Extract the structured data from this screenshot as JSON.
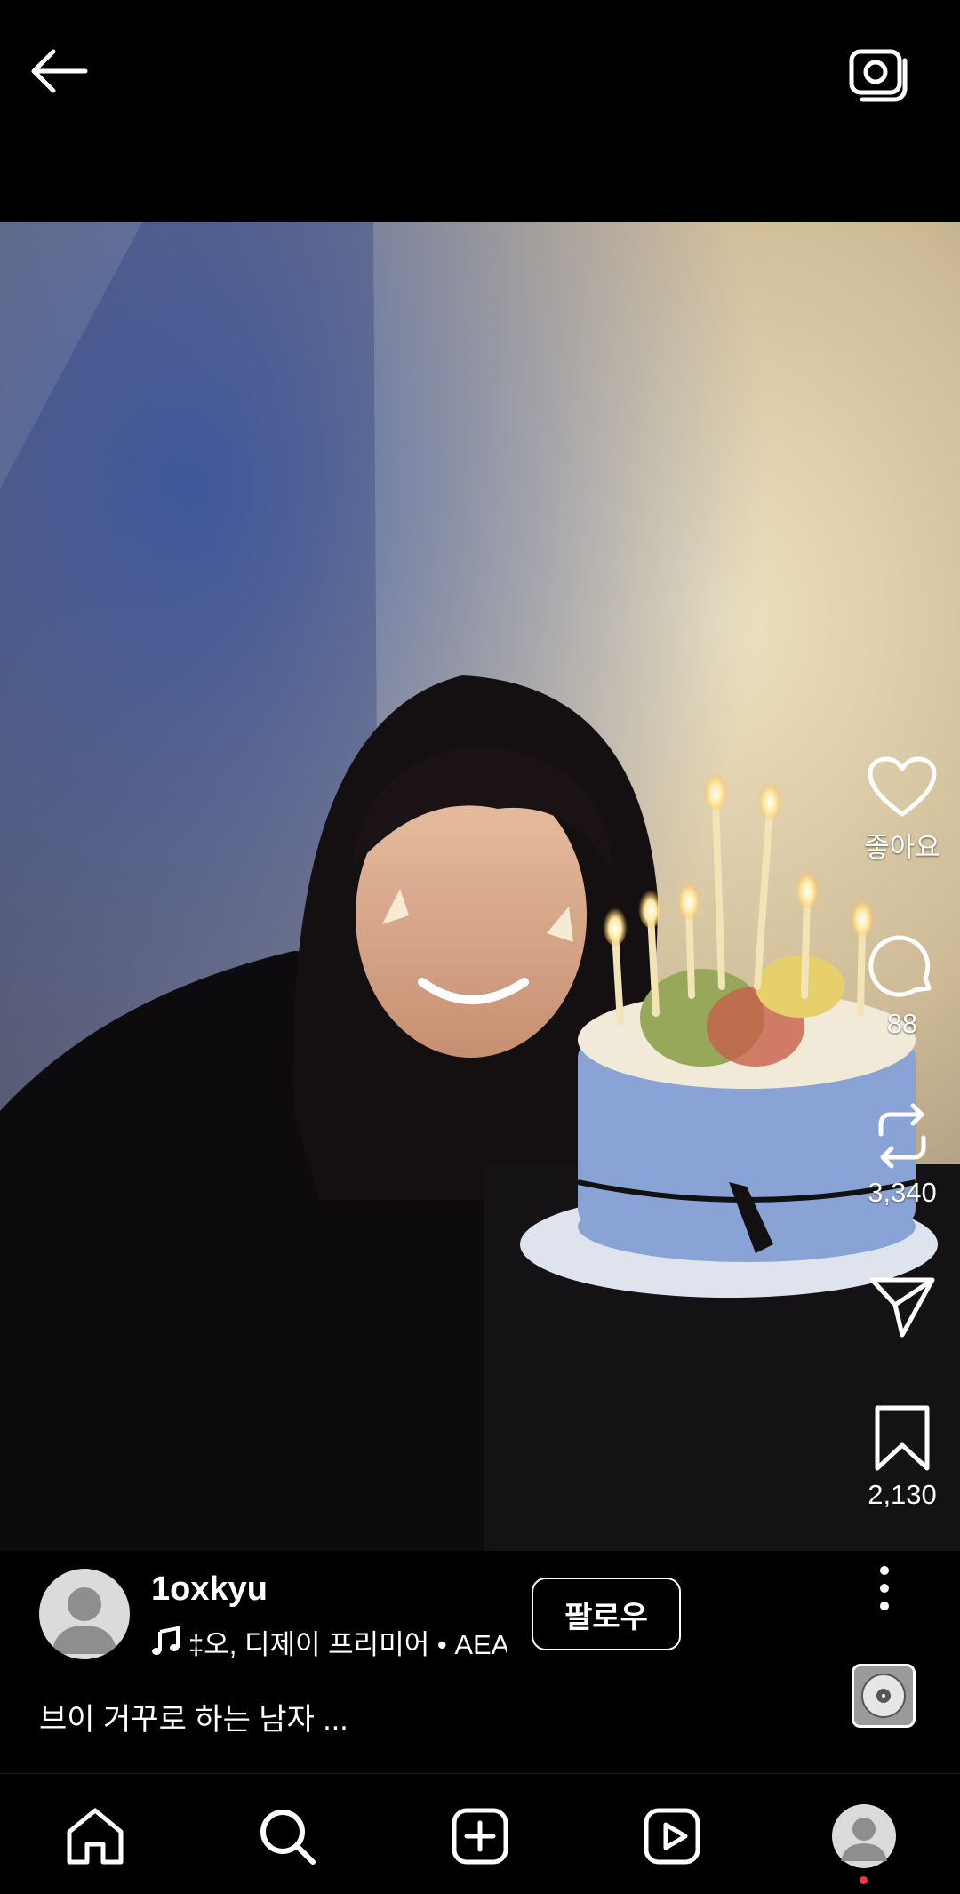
{
  "header": {
    "back_icon": "arrow-left-icon",
    "camera_icon": "camera-icon"
  },
  "actions": {
    "like": {
      "icon": "heart-icon",
      "label": "좋아요"
    },
    "comment": {
      "icon": "comment-icon",
      "count": "88"
    },
    "repost": {
      "icon": "repost-icon",
      "count": "3,340"
    },
    "share": {
      "icon": "paper-plane-icon"
    },
    "save": {
      "icon": "bookmark-icon",
      "count": "2,130"
    },
    "more": {
      "icon": "more-vertical-icon"
    }
  },
  "post": {
    "username": "1oxkyu",
    "music_text": "‡오, 디제이 프리미어 • AEA",
    "follow_label": "팔로우",
    "caption": "브이 거꾸로 하는 남자 ..."
  },
  "nav": {
    "items": [
      "home-icon",
      "search-icon",
      "create-icon",
      "reels-icon",
      "profile-icon"
    ]
  },
  "colors": {
    "background": "#000000",
    "notification_dot": "#ff3040"
  }
}
